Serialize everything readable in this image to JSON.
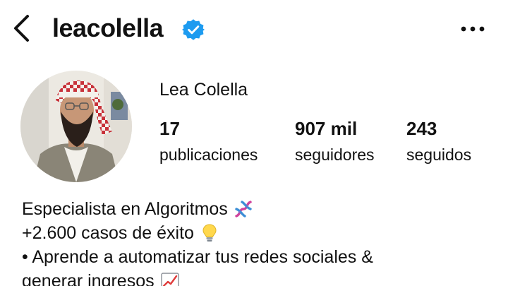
{
  "header": {
    "username": "leacolella"
  },
  "profile": {
    "display_name": "Lea Colella",
    "stats": [
      {
        "value": "17",
        "label": "publicaciones"
      },
      {
        "value": "907 mil",
        "label": "seguidores"
      },
      {
        "value": "243",
        "label": "seguidos"
      }
    ],
    "bio": [
      {
        "text": "Especialista en Algoritmos",
        "emoji": "dna-icon"
      },
      {
        "text": "+2.600 casos de éxito",
        "emoji": "lightbulb-icon"
      },
      {
        "text": "• Aprende a automatizar tus redes sociales &",
        "emoji": ""
      },
      {
        "text": "generar ingresos",
        "emoji": "chart-icon"
      }
    ]
  },
  "icons": {
    "back": "chevron-left-icon",
    "verified": "verified-badge-icon",
    "more": "more-horizontal-icon"
  },
  "colors": {
    "verified_blue": "#1d9bf0",
    "text": "#111111",
    "background": "#ffffff"
  }
}
